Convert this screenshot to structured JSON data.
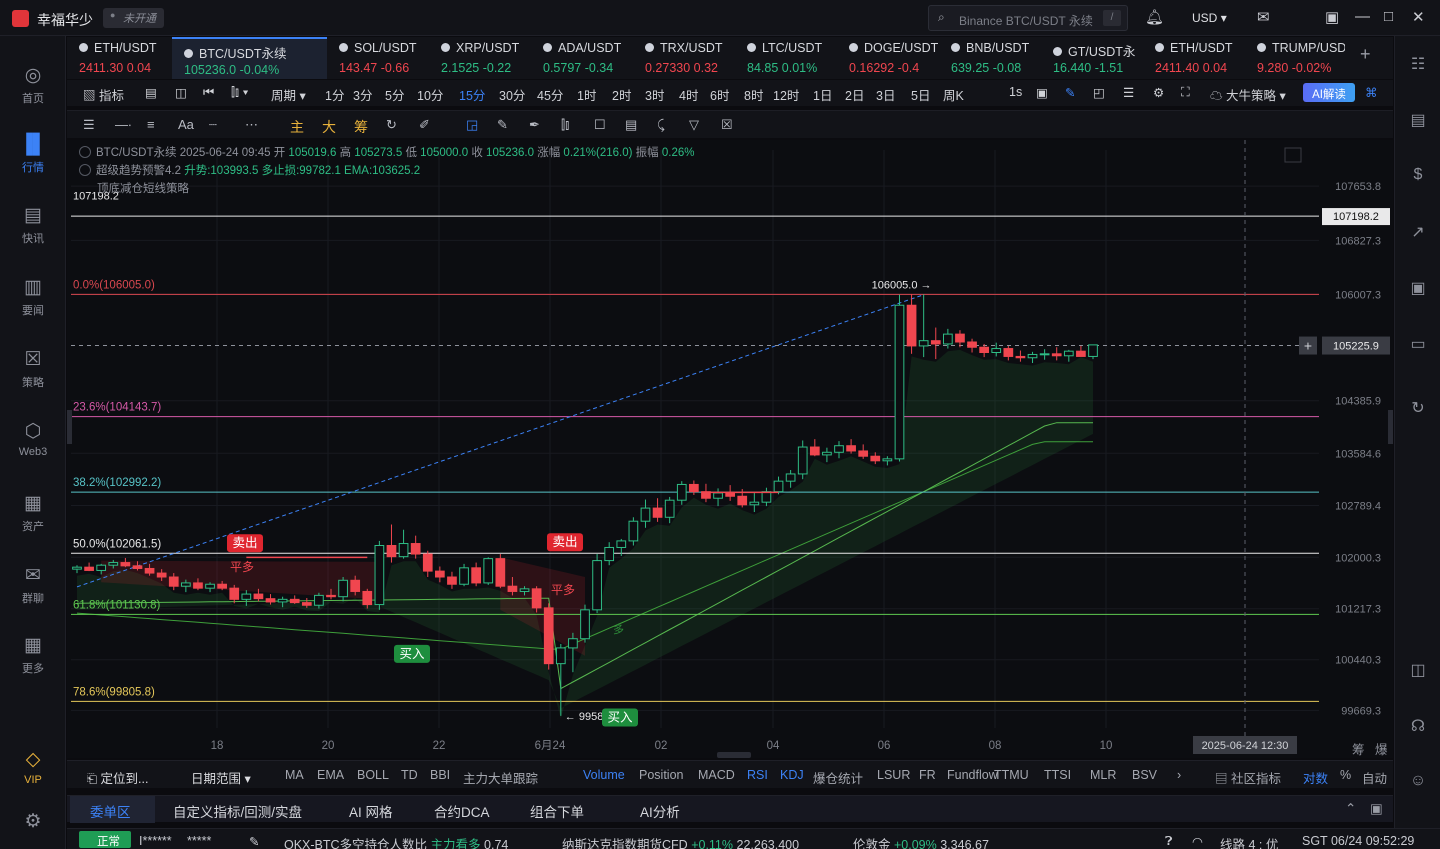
{
  "app": {
    "title": "幸福华少",
    "login_badge": "未开通",
    "search_placeholder": "Binance BTC/USDT 永续",
    "search_slash": "/",
    "currency": "USD"
  },
  "sidebar": [
    {
      "label": "首页",
      "icon": "home-icon"
    },
    {
      "label": "行情",
      "icon": "chart-bar-icon",
      "active": true
    },
    {
      "label": "快讯",
      "icon": "news-icon"
    },
    {
      "label": "要闻",
      "icon": "article-icon"
    },
    {
      "label": "策略",
      "icon": "robot-icon"
    },
    {
      "label": "Web3",
      "icon": "web3-icon"
    },
    {
      "label": "资产",
      "icon": "wallet-icon"
    },
    {
      "label": "群聊",
      "icon": "chat-icon"
    },
    {
      "label": "更多",
      "icon": "grid-icon"
    },
    {
      "label": "VIP",
      "icon": "diamond-icon"
    }
  ],
  "tabs": [
    {
      "symbol": "ETH/USDT",
      "price": "2411.30",
      "change": "0.04",
      "dir": "down"
    },
    {
      "symbol": "BTC/USDT永续",
      "price": "105236.0",
      "change": "-0.04%",
      "dir": "up",
      "active": true
    },
    {
      "symbol": "SOL/USDT",
      "price": "143.47",
      "change": "-0.66",
      "dir": "down"
    },
    {
      "symbol": "XRP/USDT",
      "price": "2.1525",
      "change": "-0.22",
      "dir": "up"
    },
    {
      "symbol": "ADA/USDT",
      "price": "0.5797",
      "change": "-0.34",
      "dir": "up"
    },
    {
      "symbol": "TRX/USDT",
      "price": "0.27330",
      "change": "0.32",
      "dir": "down"
    },
    {
      "symbol": "LTC/USDT",
      "price": "84.85",
      "change": "0.01%",
      "dir": "up"
    },
    {
      "symbol": "DOGE/USDT",
      "price": "0.16292",
      "change": "-0.4",
      "dir": "down"
    },
    {
      "symbol": "BNB/USDT",
      "price": "639.25",
      "change": "-0.08",
      "dir": "up"
    },
    {
      "symbol": "GT/USDT永",
      "price": "16.440",
      "change": "-1.51",
      "dir": "up"
    },
    {
      "symbol": "ETH/USDT",
      "price": "2411.40",
      "change": "0.04",
      "dir": "down"
    },
    {
      "symbol": "TRUMP/USDT",
      "price": "9.280",
      "change": "-0.02%",
      "dir": "down"
    }
  ],
  "toolbar1": {
    "indicator": "指标",
    "period": "周期",
    "intervals": [
      "1分",
      "3分",
      "5分",
      "10分",
      "15分",
      "30分",
      "45分",
      "1时",
      "2时",
      "3时",
      "4时",
      "6时",
      "8时",
      "12时",
      "1日",
      "2日",
      "3日",
      "5日",
      "周K"
    ],
    "selected_interval": "15分",
    "tick": "1s",
    "strategy": "大牛策略",
    "ai": "AI解读"
  },
  "toolbar2": {
    "main": "主",
    "big": "大",
    "chip": "筹"
  },
  "legend": {
    "line1": {
      "symbol": "BTC/USDT永续",
      "datetime": "2025-06-24 09:45",
      "open_label": "开",
      "open": "105019.6",
      "high_label": "高",
      "high": "105273.5",
      "low_label": "低",
      "low": "105000.0",
      "close_label": "收",
      "close": "105236.0",
      "chg_label": "涨幅",
      "chg": "0.21%(216.0)",
      "amp_label": "振幅",
      "amp": "0.26%"
    },
    "line2": {
      "name": "超级趋势预警4.2",
      "trend": "升势:103993.5",
      "stop": "多止损:99782.1",
      "ema": "EMA:103625.2"
    },
    "line3": {
      "name": "顶底减仓短线策略"
    }
  },
  "chart_data": {
    "type": "candlestick",
    "symbol": "BTC/USDT永续",
    "interval": "15分",
    "ylim": [
      99400,
      107900
    ],
    "x_ticks": [
      "18",
      "20",
      "22",
      "6月24",
      "02",
      "04",
      "06",
      "08",
      "10"
    ],
    "y_ticks": [
      "107653.8",
      "106827.3",
      "106007.3",
      "104385.9",
      "103584.6",
      "102789.4",
      "102000.3",
      "101217.3",
      "100440.3",
      "99669.3"
    ],
    "current_price": "105225.9",
    "high_line": {
      "label": "107198.2",
      "value": 107198.2
    },
    "fib_levels": [
      {
        "label": "0.0%(106005.0)",
        "value": 106005.0,
        "color": "#d9474f"
      },
      {
        "label": "23.6%(104143.7)",
        "value": 104143.7,
        "color": "#d65aa8"
      },
      {
        "label": "38.2%(102992.2)",
        "value": 102992.2,
        "color": "#57c3c7"
      },
      {
        "label": "50.0%(102061.5)",
        "value": 102061.5,
        "color": "#e9e9ea"
      },
      {
        "label": "61.8%(101130.8)",
        "value": 101130.8,
        "color": "#5fc950"
      },
      {
        "label": "78.6%(99805.8)",
        "value": 99805.8,
        "color": "#e4c75a"
      }
    ],
    "peak_label": "106005.0",
    "trough_label": "99585.7",
    "crosshair_time": "2025-06-24 12:30",
    "signals": [
      {
        "text": "卖出",
        "type": "sell"
      },
      {
        "text": "平多",
        "type": "close"
      },
      {
        "text": "买入",
        "type": "buy"
      },
      {
        "text": "卖出",
        "type": "sell"
      },
      {
        "text": "平多",
        "type": "close"
      },
      {
        "text": "买入",
        "type": "buy"
      },
      {
        "text": "多",
        "type": "long"
      }
    ],
    "candles": [
      [
        101820,
        101880,
        101760,
        101850
      ],
      [
        101850,
        101920,
        101790,
        101800
      ],
      [
        101800,
        101900,
        101740,
        101880
      ],
      [
        101880,
        101960,
        101830,
        101920
      ],
      [
        101920,
        101990,
        101850,
        101870
      ],
      [
        101870,
        101940,
        101800,
        101830
      ],
      [
        101830,
        101900,
        101720,
        101760
      ],
      [
        101760,
        101820,
        101640,
        101700
      ],
      [
        101700,
        101760,
        101500,
        101560
      ],
      [
        101560,
        101660,
        101470,
        101610
      ],
      [
        101610,
        101680,
        101500,
        101530
      ],
      [
        101530,
        101620,
        101470,
        101590
      ],
      [
        101590,
        101640,
        101500,
        101530
      ],
      [
        101530,
        101580,
        101300,
        101360
      ],
      [
        101360,
        101500,
        101260,
        101440
      ],
      [
        101440,
        101520,
        101330,
        101370
      ],
      [
        101370,
        101440,
        101280,
        101320
      ],
      [
        101320,
        101400,
        101240,
        101360
      ],
      [
        101360,
        101420,
        101290,
        101310
      ],
      [
        101310,
        101380,
        101230,
        101270
      ],
      [
        101270,
        101460,
        101220,
        101420
      ],
      [
        101420,
        101520,
        101360,
        101400
      ],
      [
        101400,
        101700,
        101330,
        101650
      ],
      [
        101650,
        101720,
        101420,
        101480
      ],
      [
        101480,
        101520,
        101220,
        101280
      ],
      [
        101280,
        102250,
        101200,
        102180
      ],
      [
        102180,
        102500,
        101920,
        102010
      ],
      [
        102010,
        102420,
        101980,
        102210
      ],
      [
        102210,
        102330,
        101980,
        102050
      ],
      [
        102050,
        102100,
        101700,
        101790
      ],
      [
        101790,
        101860,
        101620,
        101700
      ],
      [
        101700,
        101780,
        101520,
        101590
      ],
      [
        101590,
        101900,
        101560,
        101840
      ],
      [
        101840,
        101920,
        101560,
        101610
      ],
      [
        101610,
        102000,
        101580,
        101980
      ],
      [
        101980,
        102050,
        101530,
        101560
      ],
      [
        101560,
        101700,
        101420,
        101480
      ],
      [
        101480,
        101560,
        101420,
        101520
      ],
      [
        101520,
        101560,
        101160,
        101230
      ],
      [
        101230,
        101300,
        100290,
        100380
      ],
      [
        100380,
        100680,
        99585,
        100620
      ],
      [
        100620,
        100850,
        100250,
        100760
      ],
      [
        100760,
        101280,
        100700,
        101200
      ],
      [
        101200,
        102050,
        101150,
        101950
      ],
      [
        101950,
        102230,
        101880,
        102150
      ],
      [
        102150,
        102280,
        102020,
        102250
      ],
      [
        102250,
        102610,
        102180,
        102550
      ],
      [
        102550,
        102880,
        102450,
        102750
      ],
      [
        102750,
        102900,
        102540,
        102610
      ],
      [
        102610,
        102920,
        102520,
        102870
      ],
      [
        102870,
        103160,
        102800,
        103110
      ],
      [
        103110,
        103170,
        102950,
        103000
      ],
      [
        103000,
        103120,
        102840,
        102900
      ],
      [
        102900,
        103050,
        102780,
        102980
      ],
      [
        102980,
        103100,
        102860,
        102930
      ],
      [
        102930,
        103040,
        102760,
        102800
      ],
      [
        102800,
        102980,
        102690,
        102840
      ],
      [
        102840,
        103060,
        102780,
        103000
      ],
      [
        103000,
        103230,
        102960,
        103160
      ],
      [
        103160,
        103330,
        103060,
        103270
      ],
      [
        103270,
        103780,
        103190,
        103680
      ],
      [
        103680,
        103800,
        103540,
        103560
      ],
      [
        103560,
        103670,
        103450,
        103600
      ],
      [
        103600,
        103770,
        103510,
        103700
      ],
      [
        103700,
        103800,
        103580,
        103620
      ],
      [
        103620,
        103720,
        103500,
        103540
      ],
      [
        103540,
        103600,
        103420,
        103470
      ],
      [
        103470,
        103540,
        103400,
        103500
      ],
      [
        103500,
        106000,
        103460,
        105840
      ],
      [
        105840,
        106005,
        105100,
        105220
      ],
      [
        105220,
        106005,
        105050,
        105300
      ],
      [
        105300,
        105500,
        105020,
        105250
      ],
      [
        105250,
        105480,
        105180,
        105400
      ],
      [
        105400,
        105460,
        105200,
        105280
      ],
      [
        105280,
        105330,
        105120,
        105200
      ],
      [
        105200,
        105250,
        105050,
        105120
      ],
      [
        105120,
        105270,
        105060,
        105180
      ],
      [
        105180,
        105220,
        105000,
        105060
      ],
      [
        105060,
        105150,
        104980,
        105040
      ],
      [
        105040,
        105130,
        104960,
        105090
      ],
      [
        105090,
        105170,
        105010,
        105100
      ],
      [
        105100,
        105200,
        105000,
        105070
      ],
      [
        105070,
        105160,
        104980,
        105140
      ],
      [
        105140,
        105220,
        105090,
        105060
      ],
      [
        105060,
        105240,
        105020,
        105236
      ]
    ]
  },
  "indicators": {
    "locate": "定位到...",
    "date_range": "日期范围",
    "items": [
      "MA",
      "EMA",
      "BOLL",
      "TD",
      "BBI",
      "主力大单跟踪",
      "Volume",
      "Position",
      "MACD",
      "RSI",
      "KDJ",
      "爆仓统计",
      "LSUR",
      "FR",
      "Fundflow",
      "TTMU",
      "TTSI",
      "MLR",
      "BSV"
    ],
    "selected": [
      "Volume",
      "RSI",
      "KDJ"
    ],
    "community": "社区指标",
    "log_scale": "对数",
    "percent": "%",
    "auto": "自动",
    "right_labels": [
      "筹",
      "爆"
    ]
  },
  "panel_tabs": [
    "委单区",
    "自定义指标/回测/实盘",
    "AI 网格",
    "合约DCA",
    "组合下单",
    "AI分析"
  ],
  "statusbar": {
    "status": "正常",
    "masked1": "I******",
    "masked2": "*****",
    "ticker1_name": "OKX-BTC多空持仓人数比",
    "ticker1_note": "主力看多",
    "ticker1_value": "0.74",
    "ticker2_name": "纳斯达克指数期货CFD",
    "ticker2_change": "+0.11%",
    "ticker2_value": "22,263.400",
    "ticker3_name": "伦敦金",
    "ticker3_change": "+0.09%",
    "ticker3_value": "3,346.67",
    "line": "线路 4 : 优",
    "clock": "SGT 06/24 09:52:29"
  },
  "colors": {
    "up": "#2ebd85",
    "down": "#f0464f",
    "accent": "#3c82f6"
  }
}
